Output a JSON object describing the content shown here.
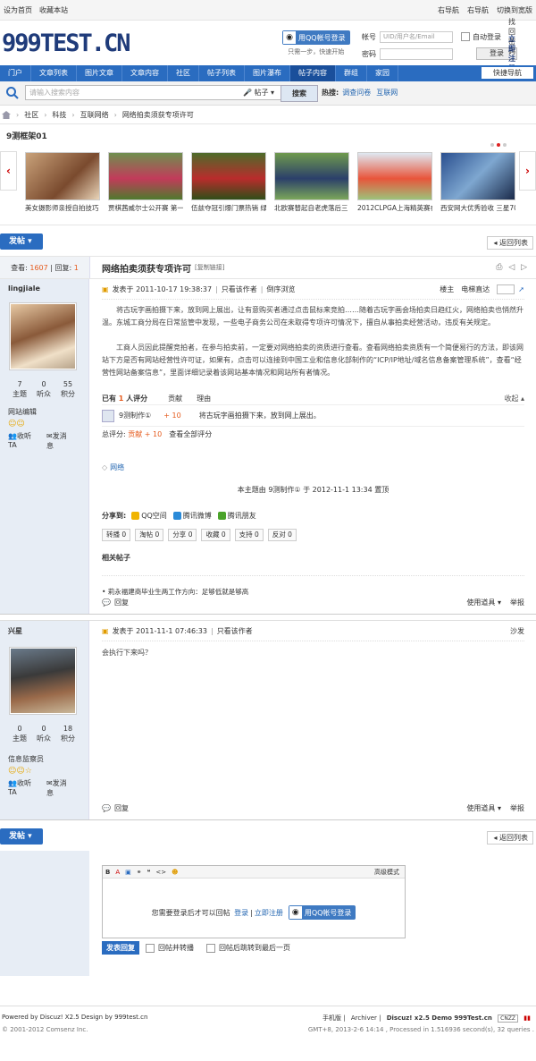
{
  "topbar": {
    "left": [
      "设为首页",
      "收藏本站"
    ],
    "right": [
      "右导航",
      "右导航",
      "切换到宽版"
    ]
  },
  "header": {
    "logo": "999TEST.CN",
    "qq_login": "用QQ帐号登录",
    "qq_sub": "只需一步，快速开始",
    "login": {
      "user_label": "帐号",
      "user_placeholder": "UID/用户名/Email",
      "auto_login": "自动登录",
      "find_pw": "找回密码",
      "pw_label": "密码",
      "login_btn": "登录",
      "register": "立即注册"
    }
  },
  "nav": {
    "items": [
      "门户",
      "文章列表",
      "图片文章",
      "文章内容",
      "社区",
      "帖子列表",
      "图片瀑布",
      "帖子内容",
      "群组",
      "家园"
    ],
    "quick": "快捷导航"
  },
  "search": {
    "placeholder": "请输入搜索内容",
    "type": "帖子",
    "button": "搜索",
    "hot_label": "热搜:",
    "hot": [
      "调查问卷",
      "互联网"
    ]
  },
  "breadcrumb": [
    "社区",
    "科技",
    "互联网络",
    "网络拍卖须获专项许可"
  ],
  "slider": {
    "title": "9测框架01",
    "items": [
      "美女摄影师亲授自拍技巧",
      "贾棋茜威尔士公开赛 第一",
      "伍兹夺冠引爆门票热销 绿",
      "北欧赛替起自老虎落后三",
      "2012CLPGA上海精英赛在",
      "西安网大优秀验收 三星70"
    ]
  },
  "actions": {
    "post": "发帖",
    "back": "返回列表"
  },
  "thread": {
    "views_label": "查看:",
    "views": "1607",
    "replies_label": "回复:",
    "replies": "1",
    "title": "网络拍卖须获专项许可",
    "copy": "[复制链接]"
  },
  "post1": {
    "user": "lingjiale",
    "stats": [
      {
        "n": "7",
        "l": "主题"
      },
      {
        "n": "0",
        "l": "听众"
      },
      {
        "n": "55",
        "l": "积分"
      }
    ],
    "role": "网站编辑",
    "follow": "收听TA",
    "msg": "发消息",
    "date": "发表于 2011-10-17 19:38:37",
    "only": "只看该作者",
    "reverse": "倒序浏览",
    "view_mode": "楼主",
    "elec": "电梯直达",
    "p1": "将古玩字画拍摄下来，放到网上展出，让有意购买者通过点击鼠标来竞拍……随着古玩字画会场拍卖日趋红火，网络拍卖也悄然升温。东城工商分局在日常监管中发现，一些电子商务公司在未取得专项许可情况下，擅自从事拍卖经营活动，违反有关规定。",
    "p2": "工商人员因此提醒竞拍者，在参与拍卖前，一定要对网络拍卖的资质进行查看。查看网络拍卖资质有一个简便易行的方法，即该网站下方是否有网站经营性许可证，如果有，点击可以连接到中国工业和信息化部制作的“ICP/IP地址/域名信息备案管理系统”，查看“经营性网站备案信息”，里面详细记录着该网站基本情况和网站所有者情况。",
    "rate": {
      "count_pre": "已有",
      "count": "1",
      "count_suf": "人评分",
      "col2": "贡献",
      "col3": "理由",
      "collapse": "收起",
      "rater": "9测制作①",
      "value": "+ 10",
      "reason": "将古玩字画拍摄下来，放到网上展出。",
      "total_label": "总评分:",
      "total_val": "贡献 + 10",
      "view_all": "查看全部评分"
    },
    "tag": "网络",
    "modnote": "本主题由 9测制作① 于 2012-11-1 13:34 置顶",
    "share_label": "分享到:",
    "share": [
      "QQ空间",
      "腾讯微博",
      "腾讯朋友"
    ],
    "buttons": [
      "转播 0",
      "淘帖 0",
      "分享 0",
      "收藏 0",
      "支持 0",
      "反对 0"
    ],
    "related_title": "相关帖子",
    "related": [
      "• 莉永福建商毕业生两工作方向：足够低就是够高"
    ],
    "reply": "回复",
    "tools": "使用道具",
    "report": "举报"
  },
  "post2": {
    "user": "兴星",
    "stats": [
      {
        "n": "0",
        "l": "主题"
      },
      {
        "n": "0",
        "l": "听众"
      },
      {
        "n": "18",
        "l": "积分"
      }
    ],
    "role": "信息监察员",
    "follow": "收听TA",
    "msg": "发消息",
    "date": "发表于 2011-11-1 07:46:33",
    "only": "只看该作者",
    "floor": "沙发",
    "body": "会执行下来吗？",
    "reply": "回复",
    "tools": "使用道具",
    "report": "举报"
  },
  "editor": {
    "advanced": "高级模式",
    "need_login": "您需要登录后才可以回帖",
    "login": "登录",
    "register": "立即注册",
    "qq": "用QQ帐号登录",
    "submit": "发表回复",
    "opt1": "回帖并转播",
    "opt2": "回帖后跳转到最后一页"
  },
  "footer": {
    "powered": "Powered by Discuz! X2.5 Design by 999test.cn",
    "copy": "© 2001-2012 Comsenz Inc.",
    "links": [
      "手机版",
      "Archiver",
      "Discuz! x2.5 Demo 999Test.cn"
    ],
    "gmt": "GMT+8, 2013-2-6 14:14 , Processed in 1.516936 second(s), 32 queries ."
  }
}
